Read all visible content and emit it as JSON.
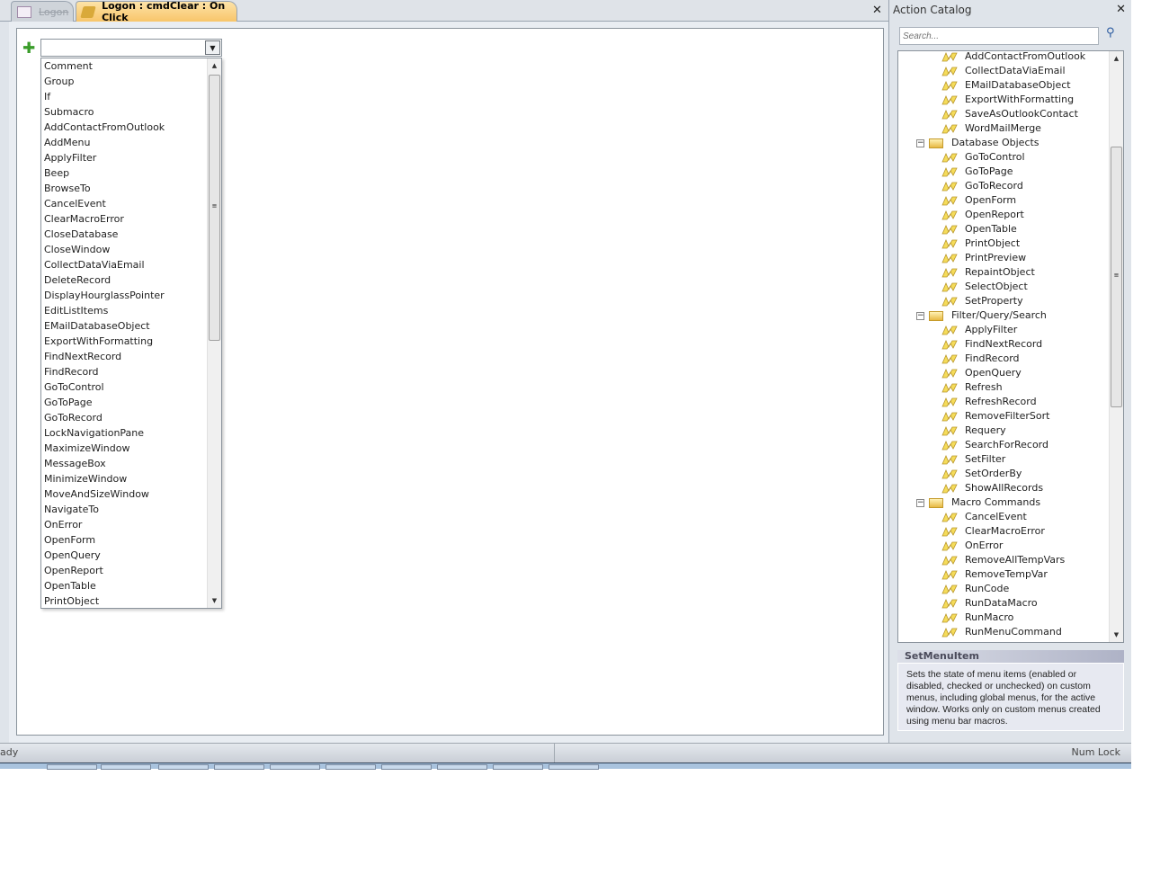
{
  "tabs": [
    {
      "label": "Logon",
      "icon": "form-icon",
      "active": false
    },
    {
      "label": "Logon : cmdClear : On Click",
      "icon": "macro-scroll-icon",
      "active": true
    }
  ],
  "macro_editor": {
    "combo_value": "",
    "action_list": [
      "Comment",
      "Group",
      "If",
      "Submacro",
      "AddContactFromOutlook",
      "AddMenu",
      "ApplyFilter",
      "Beep",
      "BrowseTo",
      "CancelEvent",
      "ClearMacroError",
      "CloseDatabase",
      "CloseWindow",
      "CollectDataViaEmail",
      "DeleteRecord",
      "DisplayHourglassPointer",
      "EditListItems",
      "EMailDatabaseObject",
      "ExportWithFormatting",
      "FindNextRecord",
      "FindRecord",
      "GoToControl",
      "GoToPage",
      "GoToRecord",
      "LockNavigationPane",
      "MaximizeWindow",
      "MessageBox",
      "MinimizeWindow",
      "MoveAndSizeWindow",
      "NavigateTo",
      "OnError",
      "OpenForm",
      "OpenQuery",
      "OpenReport",
      "OpenTable",
      "PrintObject"
    ]
  },
  "action_catalog": {
    "title": "Action Catalog",
    "search_placeholder": "Search...",
    "tree": [
      {
        "type": "leaf",
        "label": "AddContactFromOutlook"
      },
      {
        "type": "leaf",
        "label": "CollectDataViaEmail"
      },
      {
        "type": "leaf",
        "label": "EMailDatabaseObject"
      },
      {
        "type": "leaf",
        "label": "ExportWithFormatting"
      },
      {
        "type": "leaf",
        "label": "SaveAsOutlookContact"
      },
      {
        "type": "leaf",
        "label": "WordMailMerge"
      },
      {
        "type": "group",
        "label": "Database Objects"
      },
      {
        "type": "leaf",
        "label": "GoToControl"
      },
      {
        "type": "leaf",
        "label": "GoToPage"
      },
      {
        "type": "leaf",
        "label": "GoToRecord"
      },
      {
        "type": "leaf",
        "label": "OpenForm"
      },
      {
        "type": "leaf",
        "label": "OpenReport"
      },
      {
        "type": "leaf",
        "label": "OpenTable"
      },
      {
        "type": "leaf",
        "label": "PrintObject"
      },
      {
        "type": "leaf",
        "label": "PrintPreview"
      },
      {
        "type": "leaf",
        "label": "RepaintObject"
      },
      {
        "type": "leaf",
        "label": "SelectObject"
      },
      {
        "type": "leaf",
        "label": "SetProperty"
      },
      {
        "type": "group",
        "label": "Filter/Query/Search"
      },
      {
        "type": "leaf",
        "label": "ApplyFilter"
      },
      {
        "type": "leaf",
        "label": "FindNextRecord"
      },
      {
        "type": "leaf",
        "label": "FindRecord"
      },
      {
        "type": "leaf",
        "label": "OpenQuery"
      },
      {
        "type": "leaf",
        "label": "Refresh"
      },
      {
        "type": "leaf",
        "label": "RefreshRecord"
      },
      {
        "type": "leaf",
        "label": "RemoveFilterSort"
      },
      {
        "type": "leaf",
        "label": "Requery"
      },
      {
        "type": "leaf",
        "label": "SearchForRecord"
      },
      {
        "type": "leaf",
        "label": "SetFilter"
      },
      {
        "type": "leaf",
        "label": "SetOrderBy"
      },
      {
        "type": "leaf",
        "label": "ShowAllRecords"
      },
      {
        "type": "group",
        "label": "Macro Commands"
      },
      {
        "type": "leaf",
        "label": "CancelEvent"
      },
      {
        "type": "leaf",
        "label": "ClearMacroError"
      },
      {
        "type": "leaf",
        "label": "OnError"
      },
      {
        "type": "leaf",
        "label": "RemoveAllTempVars"
      },
      {
        "type": "leaf",
        "label": "RemoveTempVar"
      },
      {
        "type": "leaf",
        "label": "RunCode"
      },
      {
        "type": "leaf",
        "label": "RunDataMacro"
      },
      {
        "type": "leaf",
        "label": "RunMacro"
      },
      {
        "type": "leaf",
        "label": "RunMenuCommand"
      }
    ],
    "help_title": "SetMenuItem",
    "help_text": "Sets the state of menu items (enabled or disabled, checked or unchecked) on custom menus, including global menus, for the active window. Works only on custom menus created using menu bar macros."
  },
  "status": {
    "left": "ady",
    "right": "Num Lock"
  }
}
